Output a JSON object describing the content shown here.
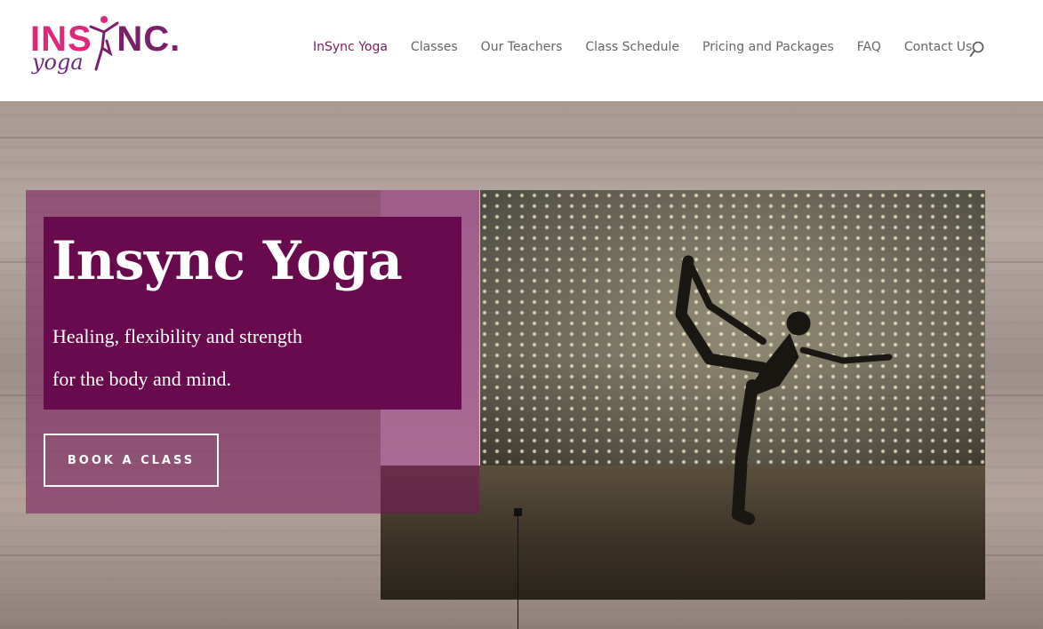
{
  "logo": {
    "wordmark": "INSYNC.",
    "subtext": "yoga",
    "colors": {
      "primary": "#7a1f6a",
      "accent": "#e0287a"
    }
  },
  "nav": {
    "items": [
      {
        "label": "InSync Yoga",
        "active": true
      },
      {
        "label": "Classes",
        "active": false
      },
      {
        "label": "Our Teachers",
        "active": false
      },
      {
        "label": "Class Schedule",
        "active": false
      },
      {
        "label": "Pricing and Packages",
        "active": false
      },
      {
        "label": "FAQ",
        "active": false
      },
      {
        "label": "Contact Us",
        "active": false
      }
    ],
    "search_icon": "search-icon",
    "active_color": "#7c1b5e",
    "text_color": "#666666"
  },
  "hero": {
    "title": "Insync Yoga",
    "tagline_line1": "Healing, flexibility and strength",
    "tagline_line2": "for the body and mind.",
    "cta_label": "BOOK A CLASS",
    "title_box_color": "#6a0a4e",
    "overlay_color": "rgba(120, 20, 90, 0.55)"
  }
}
